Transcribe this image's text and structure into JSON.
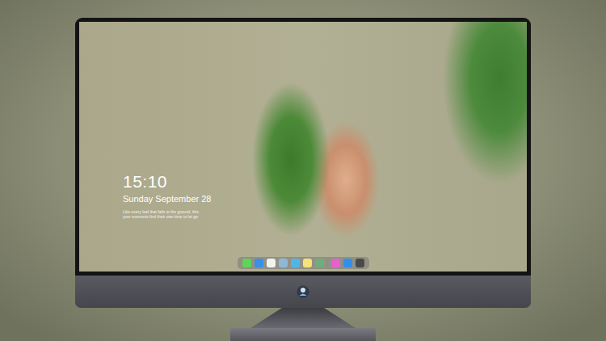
{
  "lock_screen": {
    "time": "15:10",
    "date": "Sunday September 28",
    "message_lines": [
      "Like every leaf that falls to the ground, this",
      "your moments find their own time to let go"
    ]
  },
  "dock": {
    "items": [
      {
        "kind": "app",
        "color": "#5fd35a"
      },
      {
        "kind": "app",
        "color": "#3b8fe8"
      },
      {
        "kind": "app",
        "color": "#f2f2f2"
      },
      {
        "kind": "app",
        "color": "#8fb8d8"
      },
      {
        "kind": "app",
        "color": "#4fb6e8"
      },
      {
        "kind": "app",
        "color": "#f7e27a"
      },
      {
        "kind": "app",
        "color": "#6fae7a"
      },
      {
        "kind": "divider",
        "color": "#8a8a8a"
      },
      {
        "kind": "app",
        "color": "#e75fd1"
      },
      {
        "kind": "app",
        "color": "#2f8ff0"
      },
      {
        "kind": "app",
        "color": "#4a4a4a"
      }
    ]
  }
}
